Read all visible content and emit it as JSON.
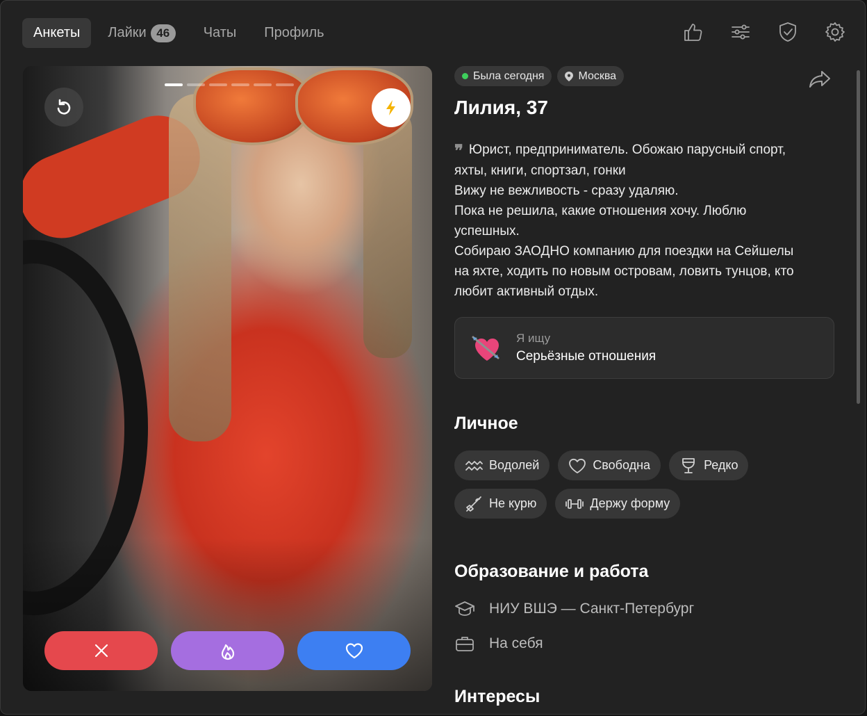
{
  "nav": {
    "tabs": [
      {
        "label": "Анкеты",
        "active": true
      },
      {
        "label": "Лайки",
        "badge": "46"
      },
      {
        "label": "Чаты"
      },
      {
        "label": "Профиль"
      }
    ],
    "icons": [
      "thumbs-up-icon",
      "filters-icon",
      "shield-check-icon",
      "gear-icon"
    ]
  },
  "photo": {
    "count": 6,
    "current": 1,
    "undo_icon": "undo-icon",
    "boost_icon": "lightning-icon",
    "boost_color": "#f5b301"
  },
  "actions": {
    "dislike_color": "#e5484d",
    "super_color": "#a56ee0",
    "like_color": "#3d7ff2"
  },
  "profile": {
    "status": "Была сегодня",
    "city": "Москва",
    "name_age": "Лилия, 37",
    "about_lines": [
      "Юрист, предприниматель. Обожаю парусный спорт,",
      "яхты, книги, спортзал, гонки",
      "Вижу не вежливость - сразу удаляю.",
      "Пока не решила, какие отношения хочу. Люблю",
      "успешных.",
      "Собираю ЗАОДНО компанию для поездки на Сейшелы",
      "на яхте, ходить по новым островам, ловить тунцов, кто",
      "любит активный отдых."
    ],
    "seek": {
      "label": "Я ищу",
      "value": "Серьёзные отношения"
    },
    "personal_title": "Личное",
    "personal_tags": [
      "Водолей",
      "Свободна",
      "Редко",
      "Не курю",
      "Держу форму"
    ],
    "edu_title": "Образование и работа",
    "education": "НИУ ВШЭ — Санкт-Петербург",
    "work": "На себя",
    "interests_title": "Интересы"
  }
}
